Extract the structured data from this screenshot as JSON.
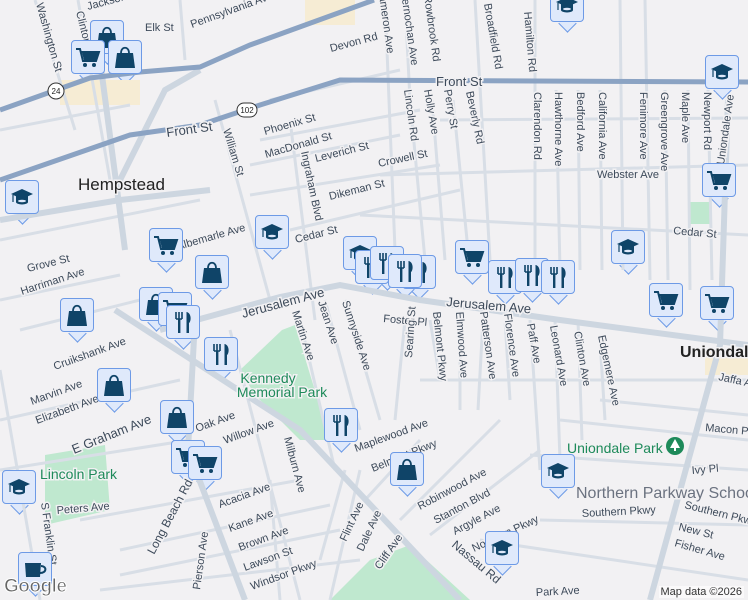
{
  "map": {
    "city": "Hempstead",
    "city2": "Uniondale",
    "parks": [
      "Kennedy",
      "Memorial Park",
      "Lincoln Park",
      "Uniondale Park"
    ],
    "poi_school": "Northern Parkway School",
    "route_shields": [
      "24",
      "102"
    ],
    "attribution": "Map data ©2026",
    "logo": "Google",
    "colors": {
      "background": "#f2f1f3",
      "highway": "#8ba3c3",
      "road": "#d5dde6",
      "park": "#bfe8cf",
      "marker_fill": "#dfe9fb",
      "marker_border": "#6d9ae6",
      "icon": "#0f4468"
    }
  },
  "streets": [
    "Washington St",
    "Clinton St",
    "Jackson St",
    "Elk St",
    "Pennsylvania Ave",
    "Devon Rd",
    "Cameron Ave",
    "Kernochan Ave",
    "Rowbrook Rd",
    "Broadfield Rd",
    "Hamilton Rd",
    "Front St",
    "Front St",
    "Lincoln Rd",
    "Holly Ave",
    "Perry St",
    "Beverly Rd",
    "Clarendon Rd",
    "Hawthorne Ave",
    "Bedford Ave",
    "California Ave",
    "Fenimore Ave",
    "Greengrove Ave",
    "Maple Ave",
    "Newport Rd",
    "Uniondale Ave",
    "Phoenix St",
    "MacDonald St",
    "Leverich St",
    "Crowell St",
    "Dikeman St",
    "Webster Ave",
    "William St",
    "Ingraham Blvd",
    "Cedar St",
    "Cedar St",
    "Albemarle Ave",
    "Grove St",
    "Harriman Ave",
    "Cruikshank Ave",
    "Marvin Ave",
    "Elizabeth Ave",
    "E Graham Ave",
    "Peters Ave",
    "S Franklin St",
    "Jerusalem Ave",
    "Jerusalem Ave",
    "Jean Ave",
    "Martin Ave",
    "Sunnyside Ave",
    "Foster Pl",
    "Searing St",
    "Belmont Pkwy",
    "Elmwood Ave",
    "Patterson Ave",
    "Florence Ave",
    "Paff Ave",
    "Leonard Ave",
    "Clinton Ave",
    "Edgemere Ave",
    "Oak Ave",
    "Willow Ave",
    "Acacia Ave",
    "Kane Ave",
    "Brown Ave",
    "Lawson St",
    "Windsor Pkwy",
    "Milburn Ave",
    "Pierson Ave",
    "Long Beach Rd",
    "Maplewood Ave",
    "Belmont Pkwy",
    "Robinwood Ave",
    "Stanton Blvd",
    "Argyle Ave",
    "Northern Pkwy",
    "Flint Ave",
    "Dale Ave",
    "Cliff Ave",
    "Nassau Rd",
    "Ivy Pl",
    "Southern Pkwy",
    "Southern Pkwy",
    "New St",
    "Fisher Ave",
    "Park Ave",
    "Jaffa Ave",
    "Macon Pl"
  ],
  "markers": [
    {
      "icon": "school"
    },
    {
      "icon": "bag"
    },
    {
      "icon": "cart"
    },
    {
      "icon": "bag"
    },
    {
      "icon": "school"
    },
    {
      "icon": "school"
    },
    {
      "icon": "cart"
    },
    {
      "icon": "bag"
    },
    {
      "icon": "school"
    },
    {
      "icon": "fork-knife"
    },
    {
      "icon": "fork-knife"
    },
    {
      "icon": "fork-knife"
    },
    {
      "icon": "fork-knife"
    },
    {
      "icon": "cart"
    },
    {
      "icon": "fork-knife"
    },
    {
      "icon": "fork-knife"
    },
    {
      "icon": "fork-knife"
    },
    {
      "icon": "school"
    },
    {
      "icon": "school"
    },
    {
      "icon": "cart"
    },
    {
      "icon": "cart"
    },
    {
      "icon": "cart"
    },
    {
      "icon": "bag"
    },
    {
      "icon": "bag"
    },
    {
      "icon": "cart"
    },
    {
      "icon": "fork-knife"
    },
    {
      "icon": "fork-knife"
    },
    {
      "icon": "bag"
    },
    {
      "icon": "bag"
    },
    {
      "icon": "cart"
    },
    {
      "icon": "cart"
    },
    {
      "icon": "fork-knife"
    },
    {
      "icon": "bag"
    },
    {
      "icon": "school"
    },
    {
      "icon": "school"
    },
    {
      "icon": "school"
    },
    {
      "icon": "coffee"
    }
  ]
}
